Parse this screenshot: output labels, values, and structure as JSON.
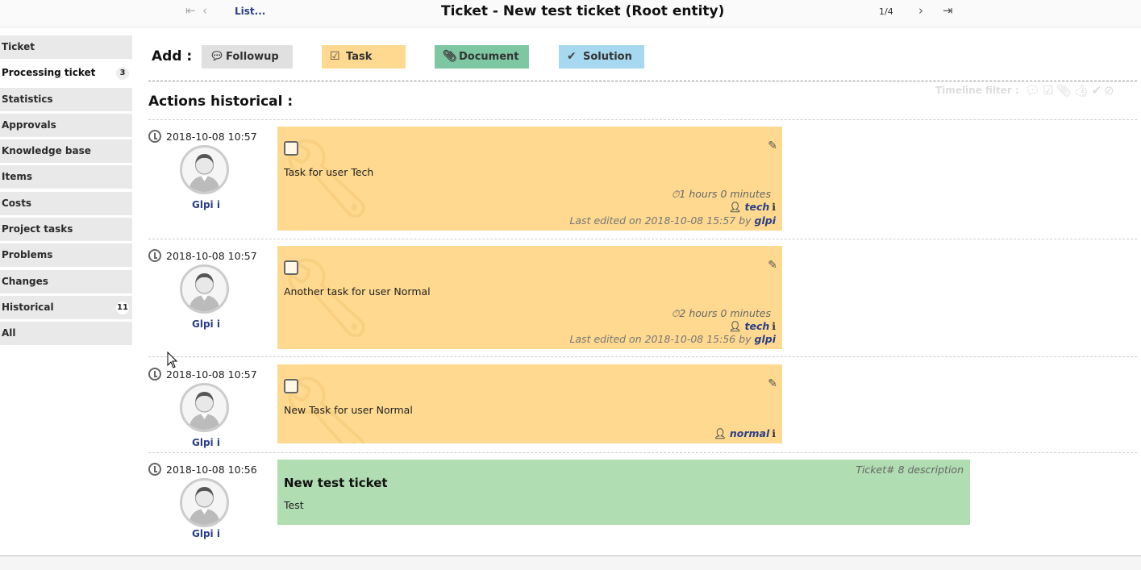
{
  "header": {
    "list_link": "List...",
    "title": "Ticket - New test ticket (Root entity)",
    "pager": "1/4"
  },
  "sidebar": {
    "items": [
      {
        "label": "Ticket",
        "badge": ""
      },
      {
        "label": "Processing ticket",
        "badge": "3"
      },
      {
        "label": "Statistics",
        "badge": ""
      },
      {
        "label": "Approvals",
        "badge": ""
      },
      {
        "label": "Knowledge base",
        "badge": ""
      },
      {
        "label": "Items",
        "badge": ""
      },
      {
        "label": "Costs",
        "badge": ""
      },
      {
        "label": "Project tasks",
        "badge": ""
      },
      {
        "label": "Problems",
        "badge": ""
      },
      {
        "label": "Changes",
        "badge": ""
      },
      {
        "label": "Historical",
        "badge": "11"
      },
      {
        "label": "All",
        "badge": ""
      }
    ]
  },
  "add": {
    "label": "Add :",
    "followup": "Followup",
    "task": "Task",
    "document": "Document",
    "solution": "Solution"
  },
  "timeline": {
    "title": "Actions historical :",
    "filter_label": "Timeline filter :",
    "items": [
      {
        "date": "2018-10-08 10:57",
        "author": "Glpi",
        "content": "Task for user Tech",
        "duration": "1 hours 0 minutes",
        "user": "tech",
        "edited_prefix": "Last edited on 2018-10-08 15:57 by",
        "edited_by": "glpi"
      },
      {
        "date": "2018-10-08 10:57",
        "author": "Glpi",
        "content": "Another task for user Normal",
        "duration": "2 hours 0 minutes",
        "user": "tech",
        "edited_prefix": "Last edited on 2018-10-08 15:56 by",
        "edited_by": "glpi"
      },
      {
        "date": "2018-10-08 10:57",
        "author": "Glpi",
        "content": "New Task for user Normal",
        "user": "normal"
      }
    ],
    "description": {
      "date": "2018-10-08 10:56",
      "author": "Glpi",
      "label": "Ticket# 8 description",
      "title": "New test ticket",
      "text": "Test"
    }
  },
  "colors": {
    "task": "#fed98f",
    "document": "#7dc8a2",
    "solution": "#a6d8ef",
    "followup": "#e0e0e0",
    "description": "#b1ddb2",
    "link": "#2a3f86"
  }
}
